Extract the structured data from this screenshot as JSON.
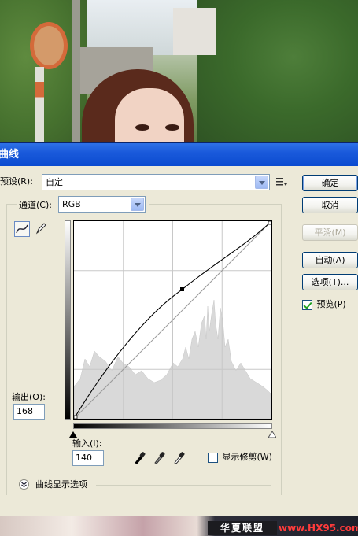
{
  "dialog": {
    "title": "曲线",
    "preset_label": "预设(R):",
    "preset_value": "自定",
    "channel_label": "通道(C):",
    "channel_value": "RGB",
    "output_label": "输出(O):",
    "output_value": "168",
    "input_label": "输入(I):",
    "input_value": "140",
    "show_clipping_label": "显示修剪(W)",
    "show_clipping_checked": false,
    "curve_display_options_label": "曲线显示选项"
  },
  "buttons": {
    "ok": "确定",
    "cancel": "取消",
    "smooth": "平滑(M)",
    "auto": "自动(A)",
    "options": "选项(T)..."
  },
  "preview": {
    "label": "预览(P)",
    "checked": true
  },
  "watermark": {
    "brand": "华夏联盟",
    "site": "www.HX95.com"
  },
  "icons": {
    "preset_menu": "preset-menu-icon",
    "curve_tool": "curve-tool-icon",
    "pencil_tool": "pencil-icon",
    "black_eyedropper": "eyedropper-black-icon",
    "gray_eyedropper": "eyedropper-gray-icon",
    "white_eyedropper": "eyedropper-white-icon",
    "expand": "expand-chevron-icon"
  },
  "colors": {
    "titlebar": "#0b4bd0",
    "dialog_bg": "#ece9d8"
  }
}
